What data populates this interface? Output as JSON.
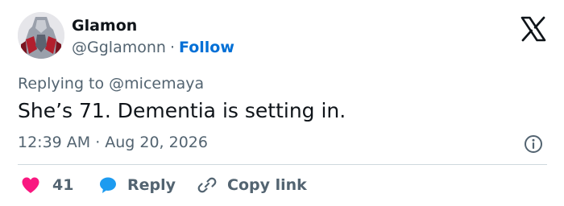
{
  "author": {
    "name": "Glamon",
    "handle": "@Gglamonn",
    "separator": "·",
    "follow_label": "Follow"
  },
  "reply_context": "Replying to @micemaya",
  "tweet_text": "She’s 71. Dementia is setting in.",
  "timestamp": {
    "time": "12:39 AM",
    "separator": "·",
    "date": "Aug 20, 2026"
  },
  "actions": {
    "like_count": "41",
    "reply_label": "Reply",
    "copy_link_label": "Copy link"
  },
  "colors": {
    "text_primary": "#0f1419",
    "text_secondary": "#536471",
    "link_blue": "#006fd6",
    "like_red": "#f91880",
    "reply_blue": "#1d9bf0",
    "divider": "#cfd9de"
  },
  "icons": {
    "logo": "x-logo-icon",
    "info": "info-icon",
    "like": "heart-icon",
    "reply": "speech-bubble-icon",
    "copy": "link-icon"
  }
}
